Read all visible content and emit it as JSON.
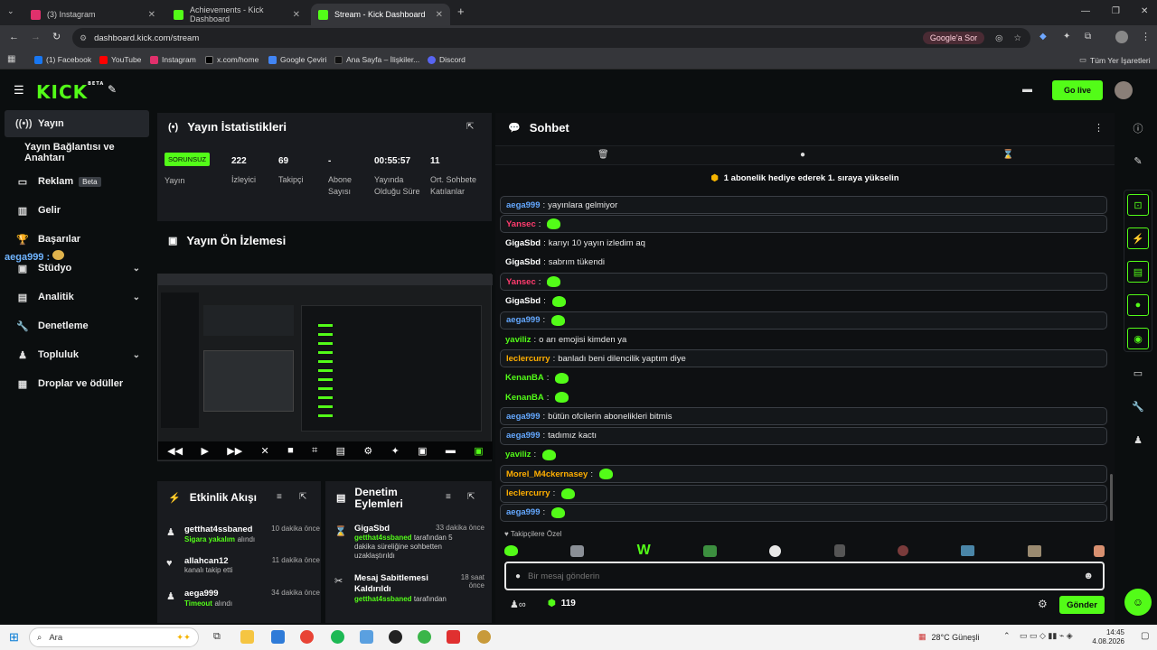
{
  "browser": {
    "tabs": [
      {
        "title": "(3) Instagram",
        "color": "#e1306c"
      },
      {
        "title": "Achievements - Kick Dashboard",
        "color": "#53fc18"
      },
      {
        "title": "Stream - Kick Dashboard",
        "color": "#53fc18"
      }
    ],
    "url": "dashboard.kick.com/stream",
    "google_btn": "Google'a Sor",
    "bookmarks": [
      "(1) Facebook",
      "YouTube",
      "Instagram",
      "x.com/home",
      "Google Çeviri",
      "Ana Sayfa – İlişkiler...",
      "Discord"
    ],
    "all_bookmarks": "Tüm Yer İşaretleri"
  },
  "header": {
    "logo": "KICK",
    "logo_sup": "BETA",
    "golive": "Go live"
  },
  "sidebar": {
    "items": [
      {
        "label": "Yayın",
        "icon": "broadcast-icon"
      },
      {
        "label": "Yayın Bağlantısı ve Anahtarı"
      },
      {
        "label": "Reklam",
        "badge": "Beta",
        "icon": "monitor-icon"
      },
      {
        "label": "Gelir",
        "icon": "chart-icon"
      },
      {
        "label": "Başarılar",
        "icon": "trophy-icon"
      },
      {
        "label": "Stüdyo",
        "icon": "studio-icon"
      },
      {
        "label": "Analitik",
        "icon": "analytics-icon"
      },
      {
        "label": "Denetleme",
        "icon": "wrench-icon"
      },
      {
        "label": "Topluluk",
        "icon": "community-icon"
      },
      {
        "label": "Droplar ve ödüller",
        "icon": "gift-icon"
      }
    ],
    "overlay_user": "aega999 :"
  },
  "stats": {
    "title": "Yayın İstatistikleri",
    "status": "SORUNSUZ",
    "status_label": "Yayın",
    "items": [
      {
        "value": "222",
        "label": "İzleyici"
      },
      {
        "value": "69",
        "label": "Takipçi"
      },
      {
        "value": "-",
        "label": "Abone Sayısı"
      },
      {
        "value": "00:55:57",
        "label": "Yayında Olduğu Süre"
      },
      {
        "value": "11",
        "label": "Ort. Sohbete Katılanlar"
      }
    ]
  },
  "preview": {
    "title": "Yayın Ön İzlemesi"
  },
  "activity": {
    "title": "Etkinlik Akışı",
    "rows": [
      {
        "user": "getthat4ssbaned",
        "text": "Sigara yakalım",
        "suffix": "alındı",
        "time": "10 dakika önce"
      },
      {
        "user": "allahcan12",
        "text": "kanalı takip etti",
        "time": "11 dakika önce"
      },
      {
        "user": "aega999",
        "text": "Timeout",
        "suffix": "alındı",
        "time": "34 dakika önce"
      }
    ]
  },
  "moderation": {
    "title": "Denetim Eylemleri",
    "rows": [
      {
        "title": "GigaSbd",
        "time": "33 dakika önce",
        "actor": "getthat4ssbaned",
        "text": "tarafından 5 dakika süreliğine sohbetten uzaklaştırıldı"
      },
      {
        "title": "Mesaj Sabitlemesi Kaldırıldı",
        "time": "18 saat önce",
        "actor": "getthat4ssbaned",
        "text": "tarafından"
      }
    ]
  },
  "chat": {
    "title": "Sohbet",
    "banner": "1 abonelik hediye ederek 1. sıraya yükselin",
    "messages": [
      {
        "user": "aega999",
        "color": "#64a8ff",
        "text": "yayınlara gelmiyor",
        "pinned": true
      },
      {
        "user": "Yansec",
        "color": "#ff3c6e",
        "text": "",
        "emote": true,
        "pinned": true
      },
      {
        "user": "GigaSbd",
        "color": "#ffffff",
        "text": "karıyı 10 yayın izledim aq"
      },
      {
        "user": "GigaSbd",
        "color": "#ffffff",
        "text": "sabrım tükendi"
      },
      {
        "user": "Yansec",
        "color": "#ff3c6e",
        "text": "",
        "emote": true,
        "pinned": true
      },
      {
        "user": "GigaSbd",
        "color": "#ffffff",
        "text": "",
        "emote": true
      },
      {
        "user": "aega999",
        "color": "#64a8ff",
        "text": "",
        "emote": true,
        "pinned": true
      },
      {
        "user": "yaviliz",
        "color": "#53fc18",
        "text": "o arı emojisi kimden ya"
      },
      {
        "user": "leclercurry",
        "color": "#ffae00",
        "text": "banladı beni dilencilik yaptım diye",
        "pinned": true
      },
      {
        "user": "KenanBA",
        "color": "#53fc18",
        "text": "",
        "emote": true
      },
      {
        "user": "KenanBA",
        "color": "#53fc18",
        "text": "",
        "emote": true
      },
      {
        "user": "aega999",
        "color": "#64a8ff",
        "text": "bütün ofcilerin abonelikleri bitmis",
        "pinned": true
      },
      {
        "user": "aega999",
        "color": "#64a8ff",
        "text": "tadımız kactı",
        "pinned": true
      },
      {
        "user": "yaviliz",
        "color": "#53fc18",
        "text": "",
        "emote": true
      },
      {
        "user": "Morel_M4ckernasey",
        "color": "#ffae00",
        "text": "",
        "emote": true,
        "pinned": true
      },
      {
        "user": "leclercurry",
        "color": "#ffae00",
        "text": "",
        "emote": true,
        "pinned": true
      },
      {
        "user": "aega999",
        "color": "#64a8ff",
        "text": "",
        "emote": true,
        "pinned": true
      }
    ],
    "follower_only": "Takipçilere Özel",
    "placeholder": "Bir mesaj gönderin",
    "viewer_count": "119",
    "send": "Gönder"
  },
  "taskbar": {
    "search": "Ara",
    "weather": "28°C  Güneşli",
    "time": "14:45",
    "date": "4.08.2026"
  },
  "colors": {
    "accent": "#53fc18",
    "bg": "#0b0e0f",
    "panel": "#191b1f"
  }
}
